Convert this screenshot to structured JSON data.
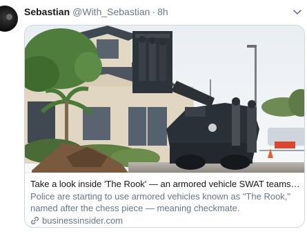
{
  "tweet": {
    "name": "Sebastian",
    "handle": "@With_Sebastian",
    "separator": "·",
    "time": "8h"
  },
  "card": {
    "image_icon": "armored-vehicle-photo",
    "title": "Take a look inside 'The Rook' — an armored vehicle SWAT teams use to ...",
    "description": "Police are starting to use armored vehicles known as \"The Rook,\" named after the chess piece — meaning checkmate.",
    "domain": "businessinsider.com",
    "link_icon": "link-icon"
  },
  "icons": {
    "caret": "chevron-down-icon"
  },
  "colors": {
    "name": "#14171a",
    "secondary": "#657786",
    "border": "#ccd6dd"
  }
}
